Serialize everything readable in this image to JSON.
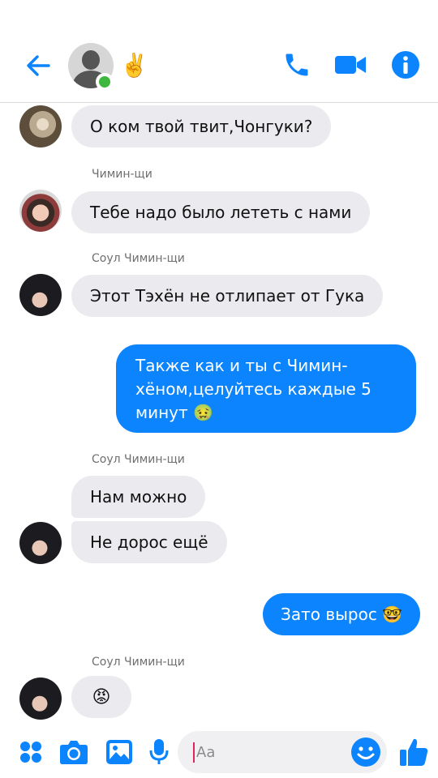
{
  "header": {
    "status_emoji": "✌️",
    "accent_color": "#0b84fe"
  },
  "icons": {
    "back": "arrow-left-icon",
    "call": "phone-icon",
    "video": "video-camera-icon",
    "info": "info-icon"
  },
  "messages": [
    {
      "side": "in",
      "sender": "",
      "text": "О ком твой твит,Чонгуки?"
    },
    {
      "side": "in",
      "sender": "Чимин-щи",
      "text": "Тебе надо было лететь с нами"
    },
    {
      "side": "in",
      "sender": "Соул Чимин-щи",
      "text": "Этот Тэхён не отлипает от Гука"
    },
    {
      "side": "out",
      "sender": "",
      "text": "Также как и ты с Чимин-хёном,целуйтесь каждые 5 минут 🤢"
    },
    {
      "side": "in",
      "sender": "Соул Чимин-щи",
      "text": "Нам можно"
    },
    {
      "side": "in",
      "sender": "",
      "text": "Не дорос ещё"
    },
    {
      "side": "out",
      "sender": "",
      "text": "Зато вырос 🤓"
    },
    {
      "side": "in",
      "sender": "Соул Чимин-щи",
      "text": "😡"
    }
  ],
  "composer": {
    "placeholder": "Aa"
  }
}
